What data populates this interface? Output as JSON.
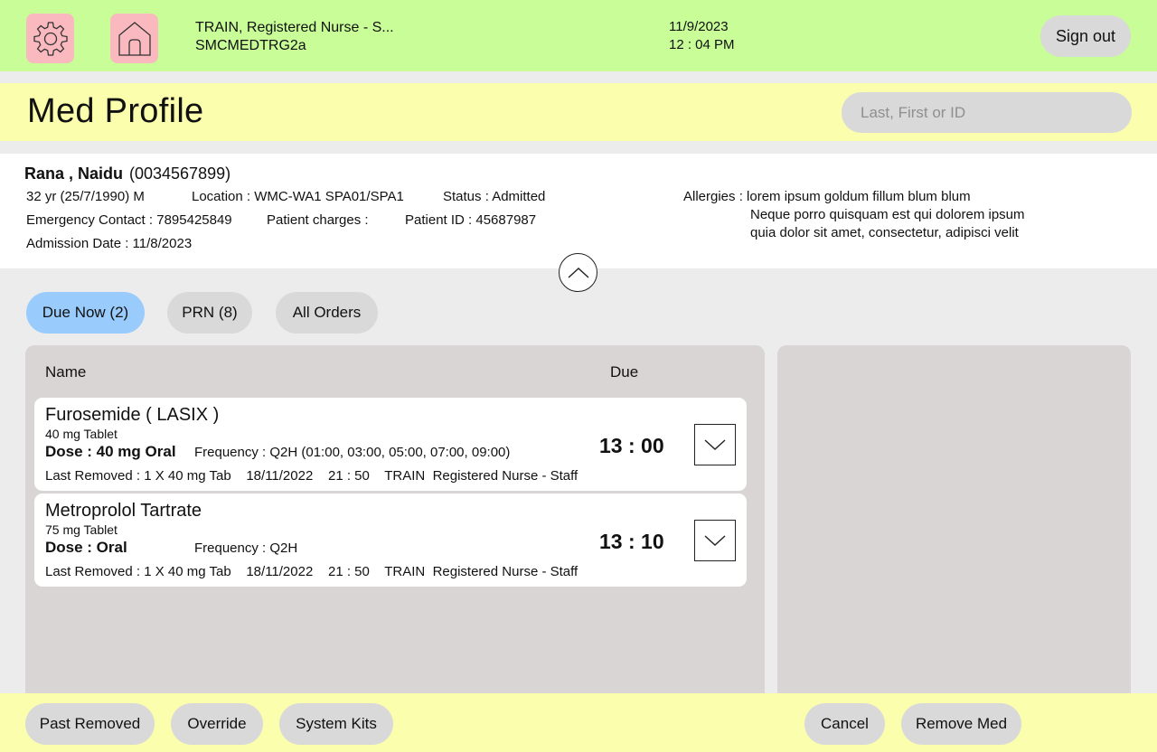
{
  "header": {
    "user_line1": "TRAIN, Registered Nurse - S...",
    "user_line2": "SMCMEDTRG2a",
    "date": "11/9/2023",
    "time": "12 : 04 PM",
    "signout_label": "Sign out",
    "icons": [
      "gear-icon",
      "home-icon"
    ]
  },
  "page": {
    "title": "Med Profile",
    "search_placeholder": "Last, First or ID"
  },
  "patient": {
    "name": "Rana , Naidu",
    "id_paren": "(0034567899)",
    "age_dob_sex": "32 yr (25/7/1990) M",
    "location": "Location : WMC-WA1 SPA01/SPA1",
    "status": "Status : Admitted",
    "emergency_contact": "Emergency Contact : 7895425849",
    "charges": "Patient charges :",
    "patient_id": "Patient ID : 45687987",
    "admission_date": "Admission Date : 11/8/2023",
    "allergies_label": "Allergies : lorem ipsum goldum fillum blum blum",
    "allergies_line2": "Neque porro quisquam est qui dolorem ipsum",
    "allergies_line3": "quia dolor sit amet, consectetur, adipisci velit"
  },
  "tabs": [
    {
      "label": "Due Now (2)",
      "active": true
    },
    {
      "label": "PRN (8)",
      "active": false
    },
    {
      "label": "All Orders",
      "active": false
    }
  ],
  "orders_table": {
    "col_name": "Name",
    "col_due": "Due",
    "rows": [
      {
        "name": "Furosemide ( LASIX )",
        "strength": "40 mg Tablet",
        "dose": "Dose : 40 mg Oral",
        "frequency": "Frequency : Q2H (01:00, 03:00, 05:00, 07:00, 09:00)",
        "last_removed": "Last Removed : 1 X 40 mg Tab    18/11/2022    21 : 50    TRAIN  Registered Nurse - Staff",
        "due": "13 : 00"
      },
      {
        "name": "Metroprolol Tartrate",
        "strength": "75 mg Tablet",
        "dose": "Dose :  Oral",
        "frequency": "Frequency : Q2H",
        "last_removed": "Last Removed : 1 X 40 mg Tab    18/11/2022    21 : 50    TRAIN  Registered Nurse - Staff",
        "due": "13 : 10"
      }
    ]
  },
  "footer": {
    "past_removed": "Past Removed",
    "override": "Override",
    "system_kits": "System Kits",
    "cancel": "Cancel",
    "remove_med": "Remove Med"
  },
  "colors": {
    "header_bg": "#c8fd98",
    "title_bg": "#fbfead",
    "icon_btn_bg": "#f9b9be",
    "active_tab": "#99ccfd",
    "pill_bg": "#d9d9d9",
    "panel_bg": "#dad5d5"
  }
}
